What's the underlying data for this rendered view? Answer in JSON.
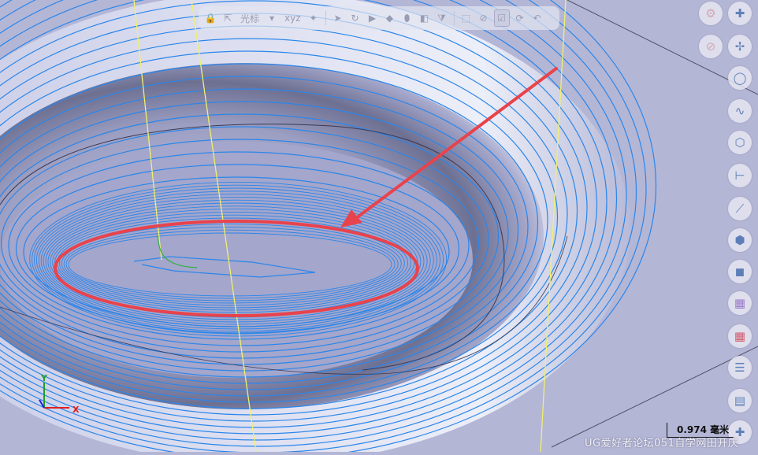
{
  "toolbar": {
    "cursor_label": "光标",
    "coord_label": "xyz",
    "icons": [
      "lock-icon",
      "select-pointer-icon",
      "dropdown-caret-icon",
      "xyz-coordinate-icon",
      "snap-point-icon",
      "arrow-select-icon",
      "view-rotate-icon",
      "view-pan-icon",
      "view-zoom-icon",
      "view-fit-icon",
      "section-icon",
      "filter-icon",
      "box-select-icon",
      "stop-icon",
      "select-check-icon",
      "refresh-icon",
      "undo-icon"
    ]
  },
  "right_toolbar": {
    "icons": [
      "settings-icon",
      "plus-icon",
      "no-entry-icon",
      "point-add-icon",
      "circle-icon",
      "curve-icon",
      "cube-view-icon",
      "dimension-icon",
      "measure-icon",
      "shaded-view-icon",
      "solid-icon",
      "color-square-icon",
      "color-square-red-icon",
      "layer-icon",
      "grid-icon",
      "add-icon"
    ]
  },
  "scale_bar": {
    "value": "0.974",
    "unit": "毫米"
  },
  "watermark": "UG爱好者论坛051自学网田开庆",
  "axes": {
    "x": "X",
    "y": "Y"
  },
  "colors": {
    "background": "#b4b6d6",
    "toolpath": "#2a86ea",
    "highlight_ellipse": "#e8434c",
    "arrow": "#e8434c",
    "yellow_line": "#f0f070",
    "axis_x": "#e02020",
    "axis_y": "#20a020",
    "axis_z": "#2020e0"
  }
}
